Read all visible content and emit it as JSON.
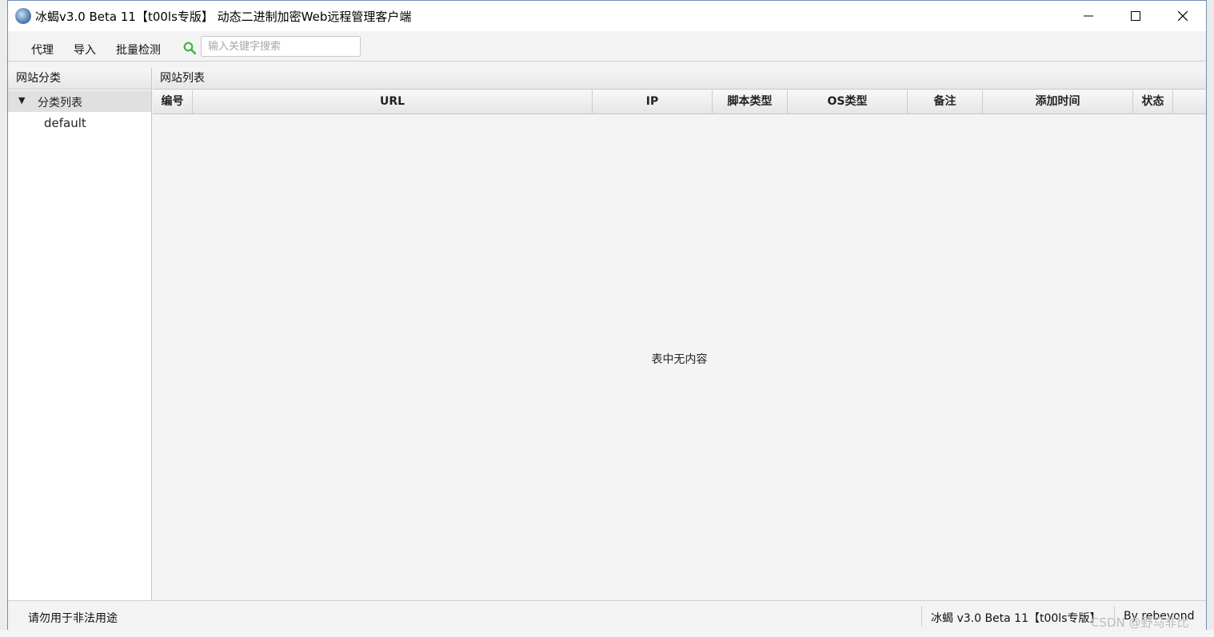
{
  "window": {
    "title": "冰蝎v3.0 Beta 11【t00ls专版】 动态二进制加密Web远程管理客户端"
  },
  "toolbar": {
    "menu": [
      {
        "label": "代理"
      },
      {
        "label": "导入"
      },
      {
        "label": "批量检测"
      }
    ],
    "search_placeholder": "输入关键字搜索",
    "search_value": ""
  },
  "left_panel": {
    "header": "网站分类",
    "tree": {
      "root_label": "分类列表",
      "children": [
        "default"
      ]
    }
  },
  "right_panel": {
    "header": "网站列表",
    "columns": [
      "编号",
      "URL",
      "IP",
      "脚本类型",
      "OS类型",
      "备注",
      "添加时间",
      "状态"
    ],
    "rows": [],
    "empty_text": "表中无内容"
  },
  "statusbar": {
    "notice": "请勿用于非法用途",
    "version": "冰蝎 v3.0 Beta 11【t00ls专版】",
    "author": "By rebeyond"
  },
  "watermark": "CSDN @野马非比",
  "colors": {
    "window_border": "#6f8fb3",
    "search_icon": "#3db83d"
  }
}
